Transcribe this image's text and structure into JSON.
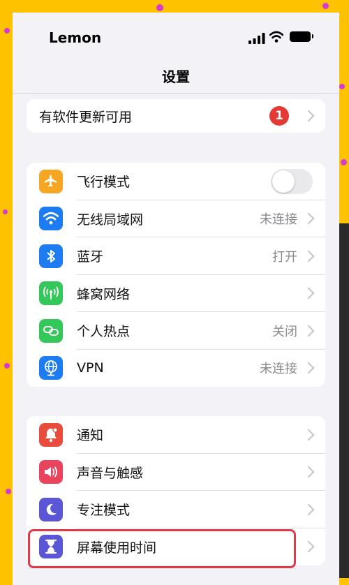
{
  "status": {
    "carrier": "Lemon"
  },
  "nav": {
    "title": "设置"
  },
  "update": {
    "label": "有软件更新可用",
    "badge": "1"
  },
  "group1": [
    {
      "label": "飞行模式",
      "value": "",
      "icon": "airplane-icon",
      "color": "#F5A623",
      "toggle": "off"
    },
    {
      "label": "无线局域网",
      "value": "未连接",
      "icon": "wifi-icon",
      "color": "#1E7CF2"
    },
    {
      "label": "蓝牙",
      "value": "打开",
      "icon": "bluetooth-icon",
      "color": "#1E7CF2"
    },
    {
      "label": "蜂窝网络",
      "value": "",
      "icon": "antenna-icon",
      "color": "#34C759"
    },
    {
      "label": "个人热点",
      "value": "关闭",
      "icon": "link-icon",
      "color": "#34C759"
    },
    {
      "label": "VPN",
      "value": "未连接",
      "icon": "globe-icon",
      "color": "#1E7CF2"
    }
  ],
  "group2": [
    {
      "label": "通知",
      "icon": "bell-icon",
      "color": "#E94B3C"
    },
    {
      "label": "声音与触感",
      "icon": "speaker-icon",
      "color": "#E9435E"
    },
    {
      "label": "专注模式",
      "icon": "moon-icon",
      "color": "#5B56D6"
    },
    {
      "label": "屏幕使用时间",
      "icon": "hourglass-icon",
      "color": "#5B56D6"
    }
  ]
}
